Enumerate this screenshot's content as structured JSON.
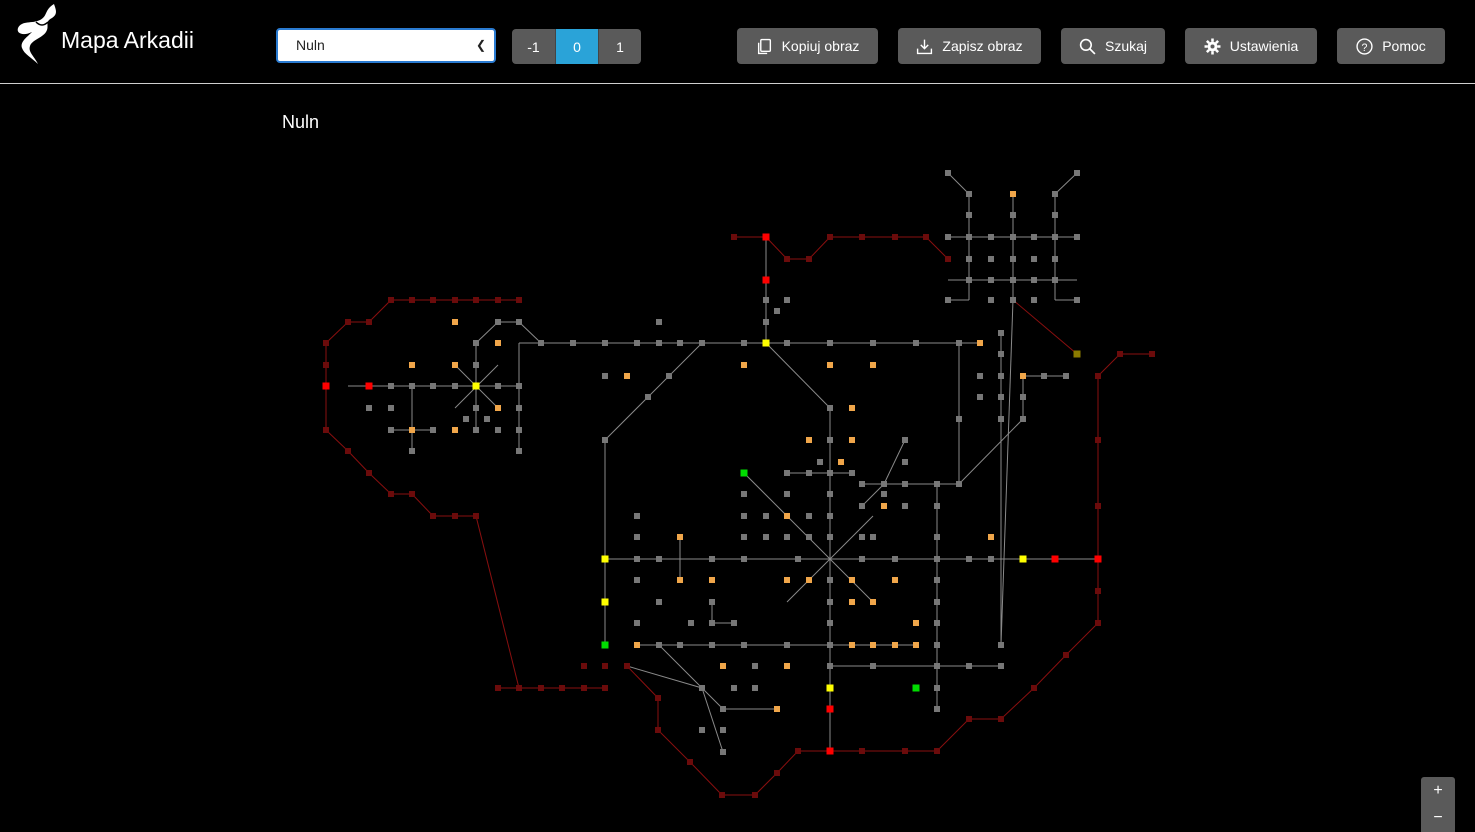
{
  "app": {
    "title": "Mapa Arkadii"
  },
  "location_select": {
    "value": "Nuln"
  },
  "levels": [
    "-1",
    "0",
    "1"
  ],
  "active_level": "0",
  "toolbar": {
    "copy_label": "Kopiuj obraz",
    "save_label": "Zapisz obraz",
    "search_label": "Szukaj",
    "settings_label": "Ustawienia",
    "help_label": "Pomoc"
  },
  "map": {
    "title": "Nuln"
  },
  "zoom": {
    "in": "+",
    "out": "−"
  },
  "colors": {
    "room": "#777777",
    "road": "#6b0b0b",
    "exit": "#ff0000",
    "special_orange": "#f0a64a",
    "special_yellow": "#ffff00",
    "special_green": "#00dd00",
    "accent": "#2aa3d8"
  }
}
